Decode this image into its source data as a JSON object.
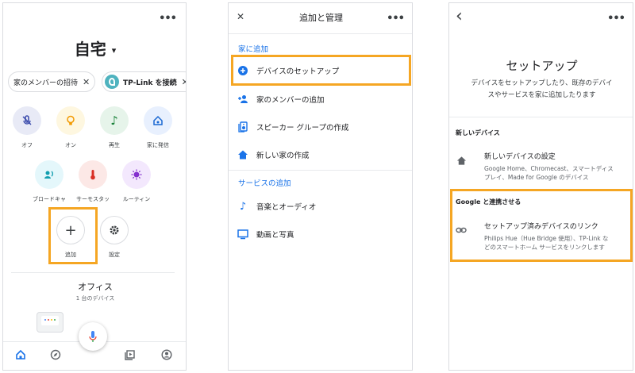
{
  "colors": {
    "highlight": "#f5a623",
    "accent_blue": "#1a73e8",
    "text": "#202124",
    "divider": "#e8eaed"
  },
  "panel1": {
    "more_icon": "more-horiz-icon",
    "home_title": "自宅",
    "home_dropdown": "▾",
    "chips": [
      {
        "label": "家のメンバーの招待",
        "close": "✕"
      },
      {
        "label": "TP-Link を接続",
        "close": "✕"
      }
    ],
    "actions_row1": [
      {
        "label": "オフ",
        "icon": "mic-off-icon",
        "bg": "#e8eaf6",
        "fg": "#3949ab"
      },
      {
        "label": "オン",
        "icon": "lightbulb-icon",
        "bg": "#fef7e0",
        "fg": "#f29900"
      },
      {
        "label": "再生",
        "icon": "music-note-icon",
        "bg": "#e6f4ea",
        "fg": "#188038"
      },
      {
        "label": "家に発信",
        "icon": "home-call-icon",
        "bg": "#e8f0fe",
        "fg": "#1967d2"
      }
    ],
    "actions_row2": [
      {
        "label": "ブロードキャ",
        "icon": "broadcast-icon",
        "bg": "#e4f7fb",
        "fg": "#129eaf"
      },
      {
        "label": "サーモスタッ",
        "icon": "thermostat-icon",
        "bg": "#fce8e6",
        "fg": "#d93025"
      },
      {
        "label": "ルーティン",
        "icon": "routine-icon",
        "bg": "#f3e8fd",
        "fg": "#8430ce"
      }
    ],
    "add_label": "追加",
    "add_symbol": "+",
    "settings_label": "設定",
    "room_title": "オフィス",
    "room_devices": "1 台のデバイス"
  },
  "panel2": {
    "close_symbol": "✕",
    "title": "追加と管理",
    "section_home": "家に追加",
    "home_items": [
      {
        "label": "デバイスのセットアップ",
        "icon": "add-circle-icon"
      },
      {
        "label": "家のメンバーの追加",
        "icon": "person-add-icon"
      },
      {
        "label": "スピーカー グループの作成",
        "icon": "speaker-group-icon"
      },
      {
        "label": "新しい家の作成",
        "icon": "home-icon"
      }
    ],
    "section_services": "サービスの追加",
    "service_items": [
      {
        "label": "音楽とオーディオ",
        "icon": "music-note-icon"
      },
      {
        "label": "動画と写真",
        "icon": "tv-icon"
      }
    ]
  },
  "panel3": {
    "back_symbol": "‹",
    "title": "セットアップ",
    "subtitle_line1": "デバイスをセットアップしたり、既存のデバイ",
    "subtitle_line2": "スやサービスを家に追加したります",
    "section_new": "新しいデバイス",
    "new_item_title": "新しいデバイスの設定",
    "new_item_desc1": "Google Home、Chromecast、スマートディス",
    "new_item_desc2": "プレイ、Made for Google のデバイス",
    "section_google": "Google と連携させる",
    "link_item_title": "セットアップ済みデバイスのリンク",
    "link_item_desc1": "Philips Hue（Hue Bridge 使用）、TP-Link な",
    "link_item_desc2": "どのスマートホーム サービスをリンクします"
  }
}
